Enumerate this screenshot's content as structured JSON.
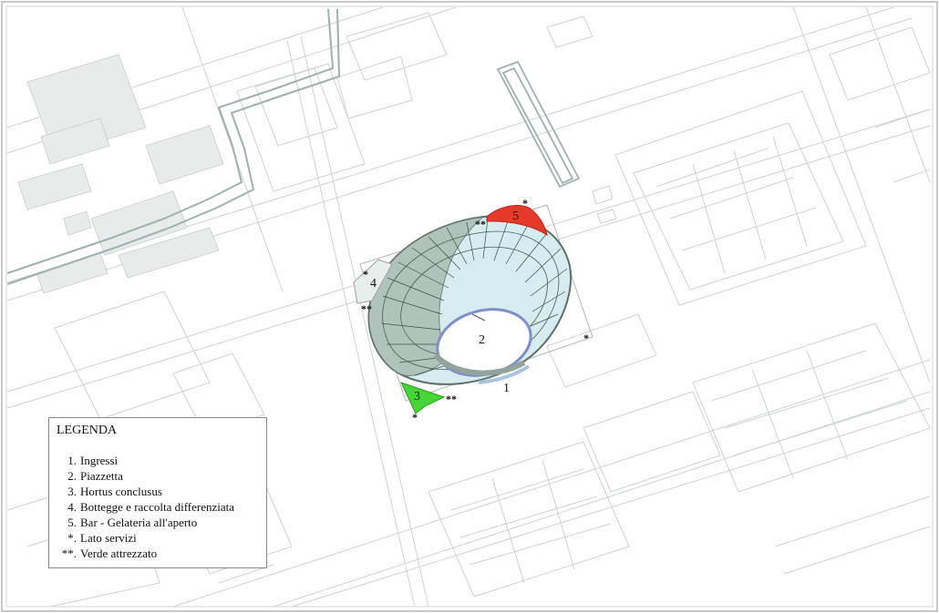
{
  "map": {
    "colors": {
      "linework": "#c9cdcd",
      "road_outline": "#9fb0b0",
      "building_fill": "#dfe6e4",
      "stadium_outer": "#8fa59a",
      "stadium_inner": "#d5ecef",
      "plaza": "#ffffff",
      "plaza_ring": "#9aa7cf",
      "bar_area": "#e53a2a",
      "garden_area": "#45d636",
      "frame": "#b5b5b5"
    },
    "labels": {
      "ingressi": "1",
      "piazzetta": "2",
      "hortus": "3",
      "botteghe": "4",
      "bar": "5"
    },
    "markers": {
      "servizi": "*",
      "verde": "**"
    }
  },
  "legend": {
    "title": "LEGENDA",
    "items": [
      {
        "key": "1.",
        "text": "Ingressi"
      },
      {
        "key": "2.",
        "text": "Piazzetta"
      },
      {
        "key": "3.",
        "text": "Hortus conclusus"
      },
      {
        "key": "4.",
        "text": "Bottegge e raccolta differenziata"
      },
      {
        "key": "5.",
        "text": "Bar - Gelateria all'aperto"
      },
      {
        "key": "*.",
        "text": "Lato servizi"
      },
      {
        "key": "**.",
        "text": "Verde attrezzato"
      }
    ]
  }
}
